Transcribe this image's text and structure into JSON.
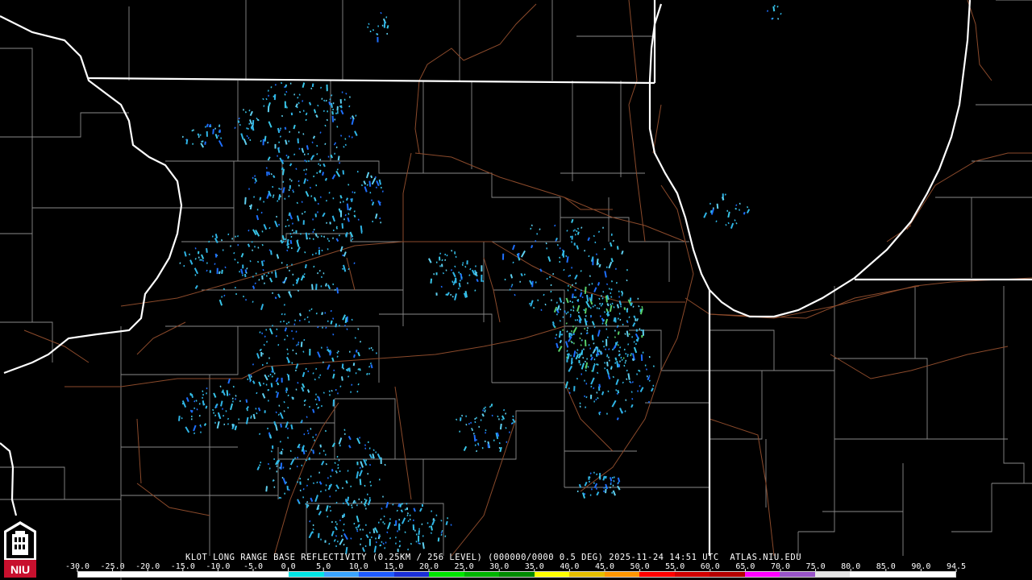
{
  "product": {
    "title": "KLOT LONG RANGE BASE REFLECTIVITY (0.25KM / 256 LEVEL) (000000/0000 0.5 DEG) 2025-11-24 14:51 UTC  ATLAS.NIU.EDU",
    "logo_text": "NIU"
  },
  "color_scale": {
    "labels": [
      "-30.0",
      "-25.0",
      "-20.0",
      "-15.0",
      "-10.0",
      "-5.0",
      "0.0",
      "5.0",
      "10.0",
      "15.0",
      "20.0",
      "25.0",
      "30.0",
      "35.0",
      "40.0",
      "45.0",
      "50.0",
      "55.0",
      "60.0",
      "65.0",
      "70.0",
      "75.0",
      "80.0",
      "85.0",
      "90.0",
      "94.5"
    ],
    "colors": [
      "#ffffff",
      "#ffffff",
      "#ffffff",
      "#ffffff",
      "#ffffff",
      "#ffffff",
      "#00e5e5",
      "#3aa4ff",
      "#1e5bff",
      "#1a2fd6",
      "#00e600",
      "#00b400",
      "#008a00",
      "#ffff00",
      "#e6be00",
      "#ff9600",
      "#ff0000",
      "#d20000",
      "#b40000",
      "#ff00ff",
      "#9955c9",
      "#e6e6e6",
      "#ffffff",
      "#ffffff",
      "#ffffff"
    ]
  },
  "colors": {
    "background": "#000000",
    "state_border": "#ffffff",
    "county_border": "#8a8a8a",
    "roads": "#8b4a2b",
    "echo_light": "#2fb5e6",
    "echo_mid": "#1e6fff",
    "echo_green": "#58d26a"
  }
}
